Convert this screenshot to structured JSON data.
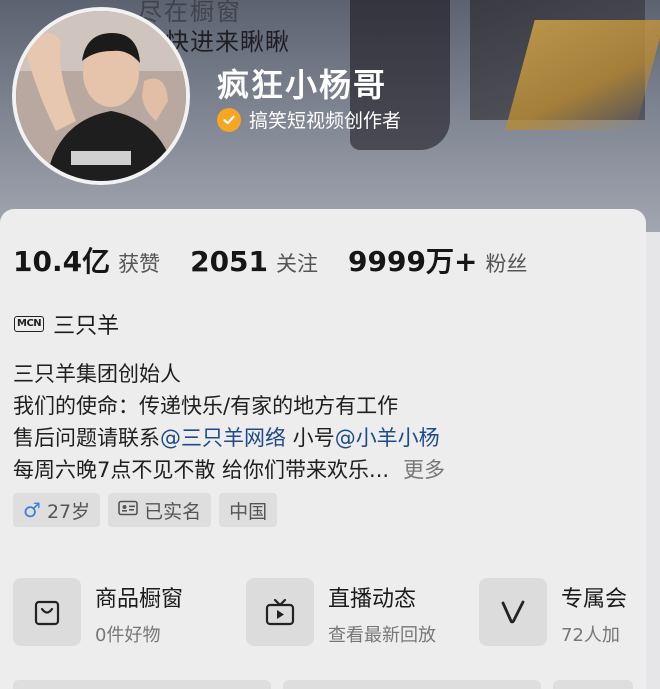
{
  "header": {
    "ghost_text_top": "尽在橱窗",
    "ghost_text_second": "快进来瞅瞅"
  },
  "profile": {
    "name": "疯狂小杨哥",
    "verify_text": "搞笑短视频创作者"
  },
  "stats": [
    {
      "value": "10.4亿",
      "label": "获赞"
    },
    {
      "value": "2051",
      "label": "关注"
    },
    {
      "value": "9999万+",
      "label": "粉丝"
    }
  ],
  "mcn": {
    "icon_text": "MCN",
    "name": "三只羊"
  },
  "bio": {
    "line1": "三只羊集团创始人",
    "line2": "我们的使命：传递快乐/有家的地方有工作",
    "line3_prefix": "售后问题请联系",
    "line3_link1": "@三只羊网络",
    "line3_mid": " 小号",
    "line3_link2": "@小羊小杨",
    "line4": "每周六晚7点不见不散  给你们带来欢乐...",
    "more": "更多"
  },
  "tags": [
    {
      "icon": "male-icon",
      "symbol": "♂",
      "text": "27岁"
    },
    {
      "icon": "id-card-icon",
      "text": "已实名"
    },
    {
      "text": "中国"
    }
  ],
  "features": [
    {
      "icon": "shopping-bag-icon",
      "title": "商品橱窗",
      "sub": "0件好物"
    },
    {
      "icon": "tv-play-icon",
      "title": "直播动态",
      "sub": "查看最新回放"
    },
    {
      "icon": "v-logo-icon",
      "title": "专属会",
      "sub": "72人加"
    }
  ],
  "colors": {
    "accent_link": "#1f4a8a",
    "verify_badge": "#f5a623",
    "male_blue": "#3b7fd6"
  }
}
